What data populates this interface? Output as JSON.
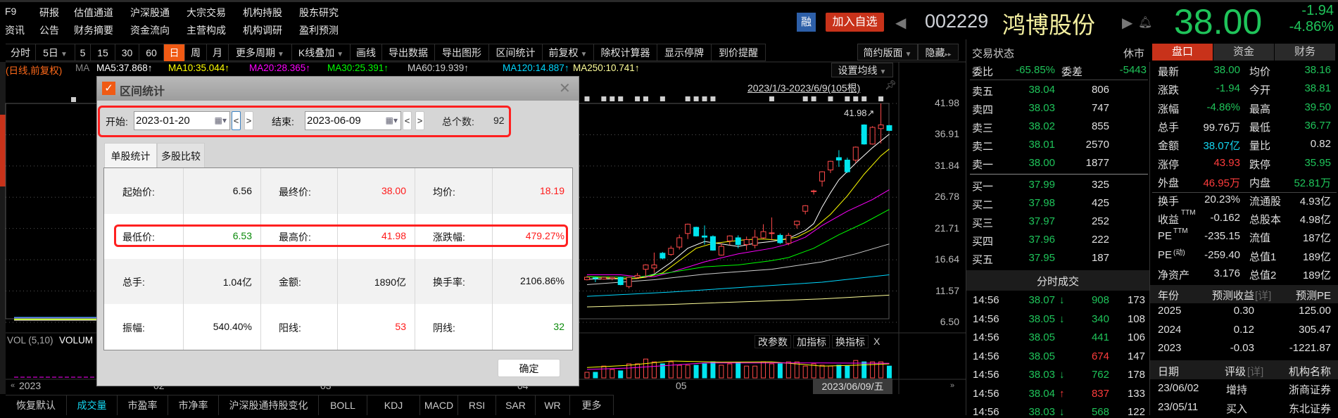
{
  "header": {
    "row1": [
      "F9",
      "研报",
      "估值通道",
      "沪深股通",
      "大宗交易",
      "机构持股",
      "股东研究"
    ],
    "row2": [
      "资讯",
      "公告",
      "财务摘要",
      "资金流向",
      "主营构成",
      "机构调研",
      "盈利预测"
    ],
    "margin_badge": "融",
    "add_watchlist": "加入自选",
    "stock_code": "002229",
    "stock_name": "鸿博股份",
    "price": "38.00",
    "change": "-1.94",
    "change_pct": "-4.86%"
  },
  "toolbar": {
    "items": [
      {
        "label": "分时"
      },
      {
        "label": "5日",
        "dropdown": true
      },
      {
        "label": "5"
      },
      {
        "label": "15"
      },
      {
        "label": "30"
      },
      {
        "label": "60"
      },
      {
        "label": "日",
        "active": true
      },
      {
        "label": "周"
      },
      {
        "label": "月"
      },
      {
        "label": "更多周期",
        "dropdown": true
      },
      {
        "label": "K线叠加",
        "dropdown": true
      },
      {
        "label": "画线"
      },
      {
        "label": "导出数据"
      },
      {
        "label": "导出图形"
      },
      {
        "label": "区间统计"
      },
      {
        "label": "前复权",
        "dropdown": true
      },
      {
        "label": "除权计算器"
      },
      {
        "label": "显示停牌"
      },
      {
        "label": "到价提醒"
      }
    ],
    "simple_layout": "简约版面",
    "hide": "隐藏"
  },
  "ma_row": {
    "prefix": "(日线,前复权)",
    "ma": "MA",
    "values": [
      {
        "label": "MA5:37.868↑",
        "color": "#ffffff"
      },
      {
        "label": "MA10:35.044↑",
        "color": "#ffff00"
      },
      {
        "label": "MA20:28.365↑",
        "color": "#ff00ff"
      },
      {
        "label": "MA30:25.391↑",
        "color": "#00ff00"
      },
      {
        "label": "MA60:19.939↑",
        "color": "#d0d0d0"
      },
      {
        "label": "MA120:14.887↑",
        "color": "#00d8ff"
      },
      {
        "label": "MA250:10.741↑",
        "color": "#ffff99"
      }
    ]
  },
  "chart_data": {
    "type": "candlestick",
    "set_ma": "设置均线",
    "range_label": "2023/1/3-2023/6/9(105根)",
    "high_label": "41.98↗",
    "y_ticks": [
      "41.98",
      "36.91",
      "31.84",
      "26.78",
      "21.71",
      "16.64",
      "11.57",
      "6.50"
    ],
    "ylim": [
      6.5,
      41.98
    ],
    "x_ticks": [
      "2023",
      "02",
      "03",
      "04",
      "05"
    ],
    "current_date": "2023/06/09/五",
    "kline": [
      [
        13.4,
        13.8,
        14.0,
        13.3
      ],
      [
        13.7,
        13.6,
        13.9,
        13.0
      ],
      [
        13.5,
        13.8,
        13.9,
        13.4
      ],
      [
        13.6,
        13.8,
        13.9,
        13.3
      ],
      [
        13.8,
        12.6,
        13.9,
        12.5
      ],
      [
        12.3,
        13.8,
        13.9,
        12.0
      ],
      [
        13.8,
        14.1,
        14.5,
        13.6
      ],
      [
        15.1,
        15.8,
        15.9,
        14.0
      ],
      [
        15.3,
        15.8,
        17.8,
        14.5
      ],
      [
        17.7,
        16.9,
        17.9,
        16.7
      ],
      [
        17.5,
        18.5,
        18.9,
        17.3
      ],
      [
        18.7,
        20.2,
        20.7,
        18.3
      ],
      [
        20.9,
        22.4,
        22.5,
        20.0
      ],
      [
        21.9,
        20.5,
        22.0,
        20.4
      ],
      [
        20.5,
        20.3,
        22.2,
        19.1
      ],
      [
        20.4,
        18.2,
        20.6,
        18.1
      ],
      [
        17.4,
        18.8,
        19.3,
        17.3
      ],
      [
        19.7,
        20.5,
        20.6,
        19.0
      ],
      [
        20.2,
        19.1,
        20.6,
        18.5
      ],
      [
        19.1,
        19.9,
        20.4,
        18.2
      ],
      [
        19.0,
        20.3,
        21.5,
        18.5
      ],
      [
        20.2,
        21.2,
        22.4,
        20.0
      ],
      [
        21.0,
        21.0,
        23.5,
        19.8
      ],
      [
        20.6,
        19.4,
        20.9,
        19.2
      ],
      [
        19.3,
        20.6,
        21.0,
        19.0
      ],
      [
        22.3,
        22.9,
        23.0,
        21.7
      ],
      [
        24.5,
        25.4,
        25.5,
        24.0
      ],
      [
        27.8,
        27.8,
        28.0,
        27.2
      ],
      [
        29.4,
        30.9,
        31.0,
        28.5
      ],
      [
        31.2,
        32.6,
        32.7,
        30.7
      ],
      [
        33.2,
        32.8,
        34.4,
        31.7
      ],
      [
        32.8,
        30.9,
        33.2,
        30.7
      ],
      [
        32.8,
        34.9,
        35.0,
        32.3
      ],
      [
        38.5,
        35.4,
        38.6,
        35.3
      ],
      [
        35.4,
        38.1,
        38.3,
        35.3
      ],
      [
        37.9,
        38.5,
        41.98,
        35.5
      ],
      [
        38.4,
        37.6,
        38.5,
        37.5
      ]
    ],
    "ma_lines": [
      {
        "name": "MA5",
        "color": "#ffffff",
        "points": [
          [
            0,
            13.5
          ],
          [
            6,
            13.6
          ],
          [
            8,
            14.3
          ],
          [
            10,
            16.2
          ],
          [
            12,
            18.5
          ],
          [
            14,
            19.6
          ],
          [
            16,
            19.2
          ],
          [
            18,
            18.8
          ],
          [
            20,
            19.3
          ],
          [
            22,
            19.6
          ],
          [
            24,
            20.1
          ],
          [
            26,
            21.4
          ],
          [
            27,
            22.5
          ],
          [
            28,
            25.2
          ],
          [
            29,
            27.5
          ],
          [
            30,
            29.6
          ],
          [
            32,
            32.3
          ],
          [
            34,
            34.8
          ],
          [
            36,
            37.0
          ]
        ]
      },
      {
        "name": "MA10",
        "color": "#ffff00",
        "points": [
          [
            0,
            13.9
          ],
          [
            5,
            13.5
          ],
          [
            7,
            13.8
          ],
          [
            9,
            14.5
          ],
          [
            11,
            16.5
          ],
          [
            13,
            18.5
          ],
          [
            15,
            19.3
          ],
          [
            17,
            19.6
          ],
          [
            19,
            19.9
          ],
          [
            21,
            20.0
          ],
          [
            23,
            19.8
          ],
          [
            25,
            20.3
          ],
          [
            27,
            21.7
          ],
          [
            29,
            24.0
          ],
          [
            31,
            27.0
          ],
          [
            33,
            30.5
          ],
          [
            35,
            33.5
          ],
          [
            36,
            34.6
          ]
        ]
      },
      {
        "name": "MA20",
        "color": "#ff00ff",
        "points": [
          [
            0,
            14.2
          ],
          [
            4,
            14.2
          ],
          [
            6,
            13.9
          ],
          [
            8,
            13.9
          ],
          [
            10,
            14.6
          ],
          [
            14,
            16.3
          ],
          [
            18,
            17.6
          ],
          [
            22,
            18.5
          ],
          [
            24,
            19.2
          ],
          [
            26,
            20.3
          ],
          [
            28,
            22.2
          ],
          [
            31,
            24.5
          ],
          [
            34,
            26.4
          ],
          [
            36,
            28.0
          ]
        ]
      },
      {
        "name": "MA30",
        "color": "#00ff00",
        "points": [
          [
            0,
            13.9
          ],
          [
            6,
            13.8
          ],
          [
            10,
            14.6
          ],
          [
            14,
            15.5
          ],
          [
            18,
            15.8
          ],
          [
            22,
            16.5
          ],
          [
            24,
            17.0
          ],
          [
            27,
            18.5
          ],
          [
            30,
            20.7
          ],
          [
            33,
            22.6
          ],
          [
            36,
            24.8
          ]
        ]
      },
      {
        "name": "MA60",
        "color": "#cfcfcf",
        "points": [
          [
            0,
            12.6
          ],
          [
            8,
            13.4
          ],
          [
            14,
            14.3
          ],
          [
            22,
            15.1
          ],
          [
            28,
            16.3
          ],
          [
            32,
            17.6
          ],
          [
            36,
            19.2
          ]
        ]
      },
      {
        "name": "MA120",
        "color": "#00d8ff",
        "points": [
          [
            0,
            10.7
          ],
          [
            10,
            11.4
          ],
          [
            20,
            12.3
          ],
          [
            28,
            13.0
          ],
          [
            36,
            14.2
          ]
        ]
      },
      {
        "name": "MA250",
        "color": "#ffff99",
        "points": [
          [
            0,
            9.0
          ],
          [
            10,
            9.4
          ],
          [
            20,
            9.9
          ],
          [
            28,
            10.3
          ],
          [
            36,
            10.9
          ]
        ]
      }
    ],
    "event_markers": [
      0,
      2,
      3,
      4,
      6,
      7,
      9,
      12,
      13,
      14,
      15,
      22,
      26,
      27,
      29,
      31,
      32,
      33,
      35
    ],
    "volume": [
      2,
      2,
      4.2,
      3,
      2.5,
      5,
      5,
      6.7,
      5.7,
      5,
      5.7,
      4.5,
      4.5,
      4.5,
      5,
      5.7,
      4.5,
      5,
      5.5,
      4.2,
      4.2,
      5.7,
      5,
      5,
      5.7,
      5.7,
      4.2,
      5,
      4.5,
      4.2,
      4.5,
      4.2,
      6.2,
      5.7,
      5.7,
      5.7,
      4.2
    ],
    "volume_ma5": [
      [
        0,
        3.7
      ],
      [
        5,
        4.5
      ],
      [
        10,
        6.0
      ],
      [
        16,
        5.6
      ],
      [
        22,
        5.7
      ],
      [
        28,
        4.2
      ],
      [
        32,
        4.5
      ],
      [
        36,
        5.0
      ]
    ],
    "volume_ma10": [
      [
        0,
        3.0
      ],
      [
        5,
        3.5
      ],
      [
        10,
        4.5
      ],
      [
        14,
        5.3
      ],
      [
        20,
        5.3
      ],
      [
        28,
        5.3
      ],
      [
        36,
        5.2
      ]
    ]
  },
  "volume_panel": {
    "label": "VOL (5,10)",
    "label2": "VOLUM",
    "buttons": [
      "改参数",
      "加指标",
      "换指标"
    ],
    "close": "X"
  },
  "bottom_tabs": [
    {
      "label": "恢复默认"
    },
    {
      "label": "成交量",
      "active": true
    },
    {
      "label": "市盈率"
    },
    {
      "label": "市净率"
    },
    {
      "label": "沪深股通持股变化"
    },
    {
      "label": "BOLL"
    },
    {
      "label": "KDJ"
    },
    {
      "label": "MACD"
    },
    {
      "label": "RSI"
    },
    {
      "label": "SAR"
    },
    {
      "label": "WR"
    },
    {
      "label": "更多"
    }
  ],
  "dialog": {
    "title": "区间统计",
    "start_label": "开始:",
    "start_date": "2023-01-20",
    "end_label": "结束:",
    "end_date": "2023-06-09",
    "prev": "<",
    "next": ">",
    "count_label": "总个数:",
    "count": "92",
    "tabs": [
      "单股统计",
      "多股比较"
    ],
    "rows": [
      [
        {
          "label": "起始价:",
          "value": "6.56",
          "color": "dk"
        },
        {
          "label": "最终价:",
          "value": "38.00",
          "color": "dr"
        },
        {
          "label": "均价:",
          "value": "18.19",
          "color": "dr"
        }
      ],
      [
        {
          "label": "最低价:",
          "value": "6.53",
          "color": "dg"
        },
        {
          "label": "最高价:",
          "value": "41.98",
          "color": "dr"
        },
        {
          "label": "涨跌幅:",
          "value": "479.27%",
          "color": "dr"
        }
      ],
      [
        {
          "label": "总手:",
          "value": "1.04亿",
          "color": "dk"
        },
        {
          "label": "金额:",
          "value": "1890亿",
          "color": "dk"
        },
        {
          "label": "换手率:",
          "value": "2106.86%",
          "color": "dk"
        }
      ],
      [
        {
          "label": "振幅:",
          "value": "540.40%",
          "color": "dk"
        },
        {
          "label": "阳线:",
          "value": "53",
          "color": "dr"
        },
        {
          "label": "阴线:",
          "value": "32",
          "color": "dg"
        }
      ]
    ],
    "ok": "确定"
  },
  "quote": {
    "status_label": "交易状态",
    "status": "休市",
    "tabs": [
      {
        "label": "盘口",
        "active": true
      },
      {
        "label": "资金"
      },
      {
        "label": "财务"
      }
    ],
    "ratio_label": "委比",
    "ratio": "-65.85%",
    "diff_label": "委差",
    "diff": "-5443",
    "asks": [
      {
        "label": "卖五",
        "price": "38.04",
        "vol": "806"
      },
      {
        "label": "卖四",
        "price": "38.03",
        "vol": "747"
      },
      {
        "label": "卖三",
        "price": "38.02",
        "vol": "855"
      },
      {
        "label": "卖二",
        "price": "38.01",
        "vol": "2570"
      },
      {
        "label": "卖一",
        "price": "38.00",
        "vol": "1877"
      }
    ],
    "bids": [
      {
        "label": "买一",
        "price": "37.99",
        "vol": "325"
      },
      {
        "label": "买二",
        "price": "37.98",
        "vol": "425"
      },
      {
        "label": "买三",
        "price": "37.97",
        "vol": "252"
      },
      {
        "label": "买四",
        "price": "37.96",
        "vol": "222"
      },
      {
        "label": "买五",
        "price": "37.95",
        "vol": "187"
      }
    ],
    "stats": [
      {
        "l1": "最新",
        "v1": "38.00",
        "c1": "g",
        "l2": "均价",
        "v2": "38.16",
        "c2": "g"
      },
      {
        "l1": "涨跌",
        "v1": "-1.94",
        "c1": "g",
        "l2": "今开",
        "v2": "38.81",
        "c2": "g"
      },
      {
        "l1": "涨幅",
        "v1": "-4.86%",
        "c1": "g",
        "l2": "最高",
        "v2": "39.50",
        "c2": "g"
      },
      {
        "l1": "总手",
        "v1": "99.76万",
        "c1": "w",
        "l2": "最低",
        "v2": "36.77",
        "c2": "g"
      },
      {
        "l1": "金额",
        "v1": "38.07亿",
        "c1": "c",
        "l2": "量比",
        "v2": "0.82",
        "c2": "w"
      },
      {
        "l1": "涨停",
        "v1": "43.93",
        "c1": "r",
        "l2": "跌停",
        "v2": "35.95",
        "c2": "g"
      },
      {
        "l1": "外盘",
        "v1": "46.95万",
        "c1": "r",
        "l2": "内盘",
        "v2": "52.81万",
        "c2": "g"
      }
    ],
    "stats2": [
      {
        "l1": "换手",
        "v1": "20.23%",
        "l2": "流通股",
        "v2": "4.93亿"
      },
      {
        "l1": "收益",
        "sup": "TTM",
        "v1": "-0.162",
        "l2": "总股本",
        "v2": "4.98亿"
      },
      {
        "l1": "PE",
        "sup": "TTM",
        "v1": "-235.15",
        "l2": "流值",
        "v2": "187亿"
      },
      {
        "l1": "PE",
        "sup": "(动)",
        "v1": "-259.40",
        "l2": "总值1",
        "v2": "189亿"
      },
      {
        "l1": "净资产",
        "v1": "3.176",
        "l2": "总值2",
        "v2": "189亿"
      }
    ],
    "trades_title": "分时成交",
    "trades": [
      {
        "time": "14:56",
        "price": "38.07",
        "arrow": "↓",
        "ac": "g",
        "vol": "908",
        "vc": "g",
        "count": "173"
      },
      {
        "time": "14:56",
        "price": "38.05",
        "arrow": "↓",
        "ac": "g",
        "vol": "340",
        "vc": "g",
        "count": "108"
      },
      {
        "time": "14:56",
        "price": "38.05",
        "arrow": "",
        "ac": "g",
        "vol": "441",
        "vc": "g",
        "count": "106"
      },
      {
        "time": "14:56",
        "price": "38.05",
        "arrow": "",
        "ac": "g",
        "vol": "674",
        "vc": "r",
        "count": "147"
      },
      {
        "time": "14:56",
        "price": "38.03",
        "arrow": "↓",
        "ac": "g",
        "vol": "762",
        "vc": "g",
        "count": "178"
      },
      {
        "time": "14:56",
        "price": "38.04",
        "arrow": "↑",
        "ac": "r",
        "vol": "837",
        "vc": "r",
        "count": "133"
      },
      {
        "time": "14:56",
        "price": "38.03",
        "arrow": "↓",
        "ac": "g",
        "vol": "568",
        "vc": "g",
        "count": "122"
      }
    ],
    "forecast": {
      "h1": "年份",
      "h2": "预测收益",
      "detail": "[详]",
      "h3": "预测PE",
      "rows": [
        {
          "year": "2025",
          "eps": "0.30",
          "pe": "125.00"
        },
        {
          "year": "2024",
          "eps": "0.12",
          "pe": "305.47"
        },
        {
          "year": "2023",
          "eps": "-0.03",
          "pe": "-1221.87"
        }
      ]
    },
    "ratings": {
      "h1": "日期",
      "h2": "评级",
      "detail": "[详]",
      "h3": "机构名称",
      "rows": [
        {
          "date": "23/06/02",
          "rating": "增持",
          "org": "浙商证券"
        },
        {
          "date": "23/05/11",
          "rating": "买入",
          "org": "东北证券"
        }
      ]
    }
  }
}
